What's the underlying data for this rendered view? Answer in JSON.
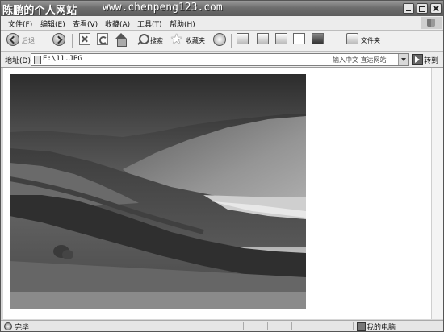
{
  "window": {
    "title": "陈鹏的个人网站",
    "url_caption": "www.chenpeng123.com"
  },
  "menu": {
    "items": [
      "文件(F)",
      "编辑(E)",
      "查看(V)",
      "收藏(A)",
      "工具(T)",
      "帮助(H)"
    ]
  },
  "toolbar": {
    "back_label": "后退",
    "search_label": "搜索",
    "favorites_label": "收藏夹",
    "folders_label": "文件夹"
  },
  "address": {
    "label": "地址(D)",
    "value": "E:\\11.JPG",
    "hint": "输入中文 直达网站",
    "go_label": "转到"
  },
  "status": {
    "text": "完毕",
    "zone": "我的电脑"
  },
  "icons": [
    "app-icon",
    "back-icon",
    "forward-icon",
    "stop-icon",
    "refresh-icon",
    "home-icon",
    "search-icon",
    "favorites-star-icon",
    "media-icon",
    "mail-icon",
    "print-icon",
    "edit-icon",
    "discuss-icon",
    "messenger-icon",
    "folder-icon",
    "go-arrow-icon",
    "done-icon",
    "my-computer-icon"
  ],
  "colors": {
    "titlebar": "#6e6e6e",
    "page_background": "#ffffff"
  }
}
